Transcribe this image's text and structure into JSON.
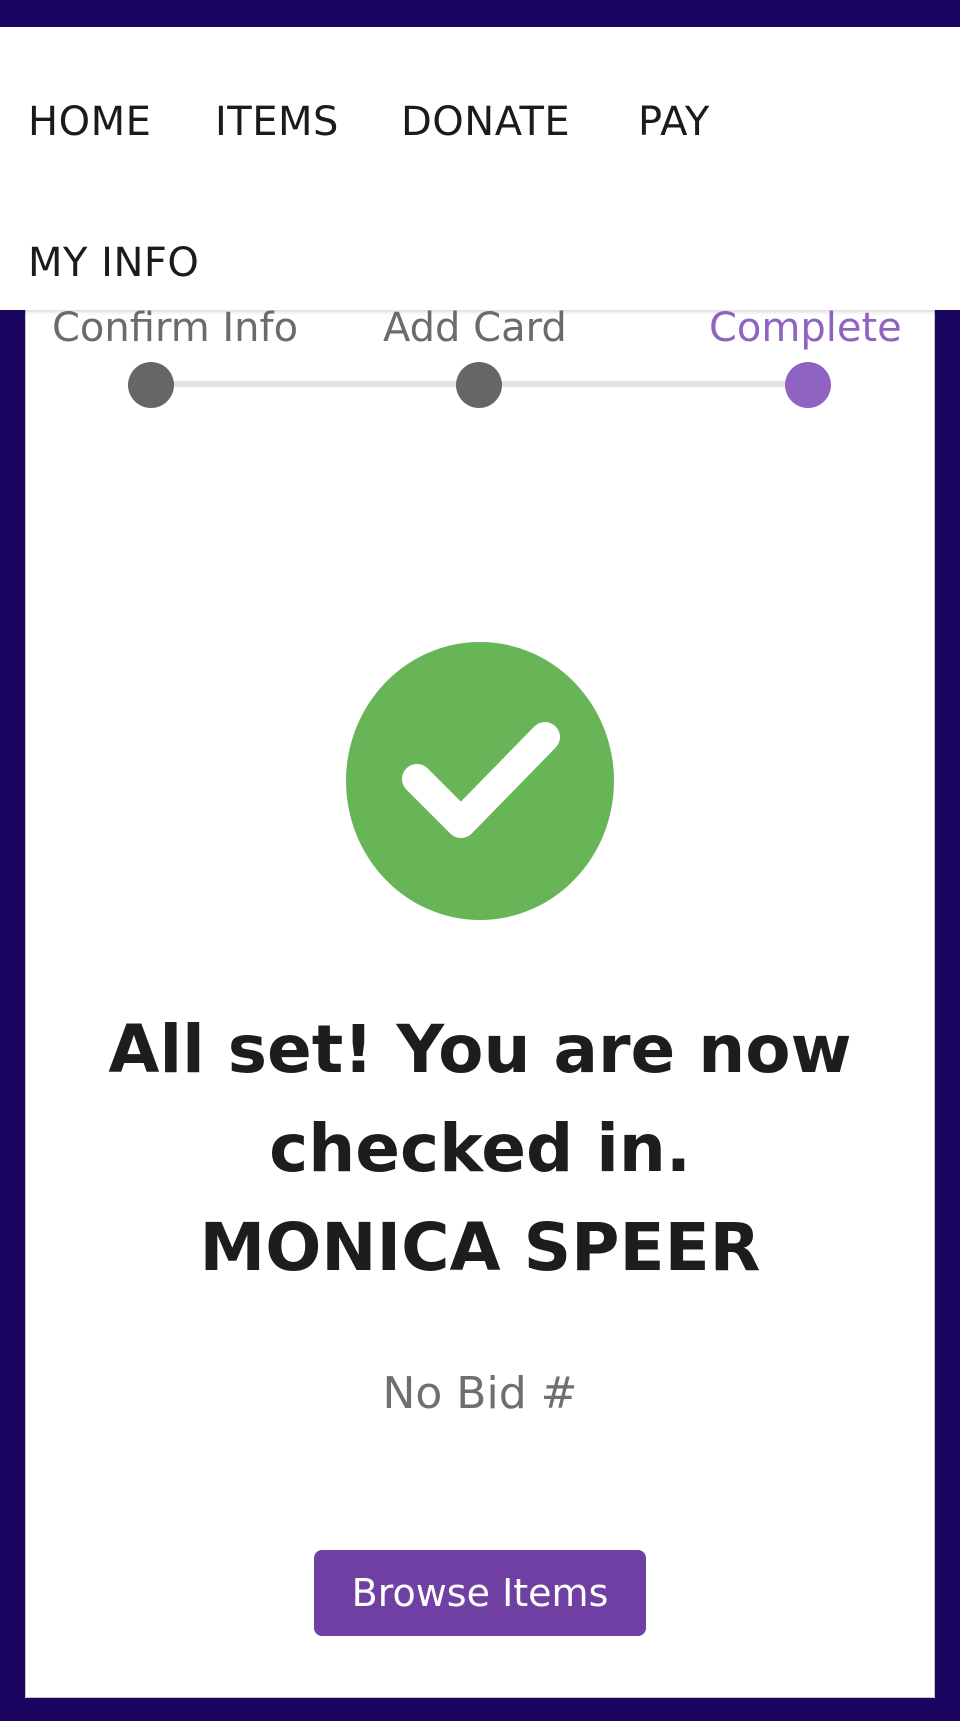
{
  "nav": {
    "items": [
      {
        "label": "HOME"
      },
      {
        "label": "ITEMS"
      },
      {
        "label": "DONATE"
      },
      {
        "label": "PAY"
      },
      {
        "label": "MY INFO"
      }
    ]
  },
  "steps": [
    {
      "label": "Confirm Info",
      "state": "done"
    },
    {
      "label": "Add Card",
      "state": "done"
    },
    {
      "label": "Complete",
      "state": "active"
    }
  ],
  "colors": {
    "background": "#1a0660",
    "accent": "#6f3fa3",
    "active_step": "#8e63c1",
    "inactive_step": "#666666",
    "success": "#68b558"
  },
  "success_icon": "check-circle-icon",
  "confirmation": {
    "line1": "All set! You are now",
    "line2": "checked in.",
    "name": "MONICA SPEER"
  },
  "bid_text": "No Bid #",
  "browse_button_label": "Browse Items"
}
